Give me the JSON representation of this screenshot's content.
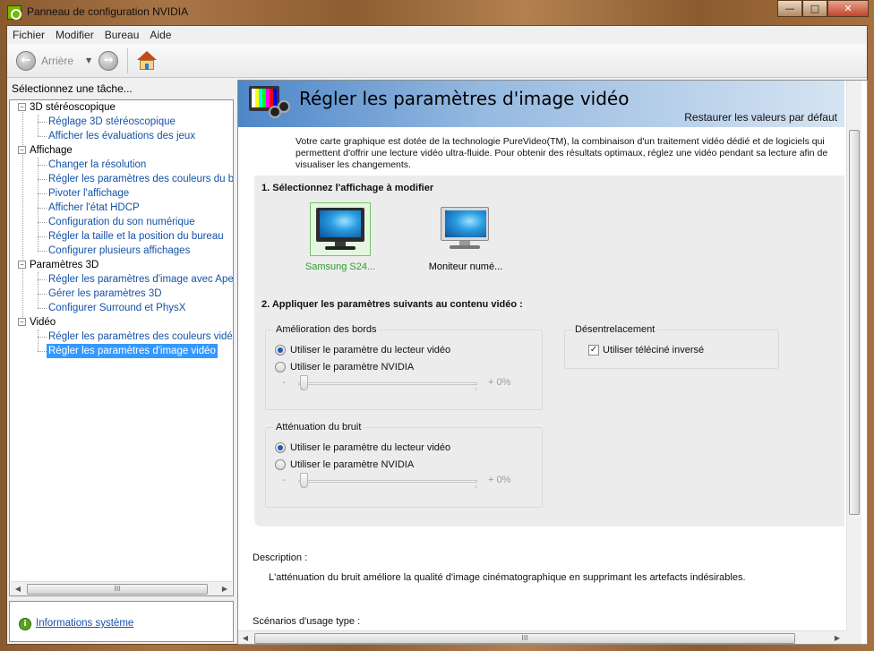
{
  "window": {
    "title": "Panneau de configuration NVIDIA",
    "min_glyph": "—",
    "max_glyph": "□",
    "close_glyph": "✕"
  },
  "menu": [
    "Fichier",
    "Modifier",
    "Bureau",
    "Aide"
  ],
  "toolbar": {
    "back_label": "Arrière",
    "back_glyph": "←",
    "forward_glyph": "→",
    "dropdown_glyph": "▼"
  },
  "left": {
    "header": "Sélectionnez une tâche...",
    "categories": [
      {
        "label": "3D stéréoscopique",
        "items": [
          "Réglage 3D stéréoscopique",
          "Afficher les évaluations des jeux"
        ]
      },
      {
        "label": "Affichage",
        "items": [
          "Changer la résolution",
          "Régler les paramètres des couleurs du bureau",
          "Pivoter l'affichage",
          "Afficher l'état HDCP",
          "Configuration du son numérique",
          "Régler la taille et la position du bureau",
          "Configurer plusieurs affichages"
        ]
      },
      {
        "label": "Paramètres 3D",
        "items": [
          "Régler les paramètres d'image avec Aperçu",
          "Gérer les paramètres 3D",
          "Configurer Surround et PhysX"
        ]
      },
      {
        "label": "Vidéo",
        "items": [
          "Régler les paramètres des couleurs vidéo",
          "Régler les paramètres d'image vidéo"
        ]
      }
    ],
    "selected_item": "Régler les paramètres d'image vidéo",
    "collapse_glyph": "−",
    "sysinfo_link": "Informations système"
  },
  "scroll": {
    "left_glyph": "◀",
    "right_glyph": "▶",
    "grip_glyph": "III"
  },
  "page": {
    "title": "Régler les paramètres d'image vidéo",
    "restore": "Restaurer les valeurs par défaut",
    "intro": "Votre carte graphique est dotée de la technologie PureVideo(TM), la combinaison d'un traitement vidéo dédié et de logiciels qui permettent d'offrir une lecture vidéo ultra-fluide. Pour obtenir des résultats optimaux, réglez une vidéo pendant sa lecture afin de visualiser les changements.",
    "section1": "1. Sélectionnez l'affichage à modifier",
    "displays": [
      {
        "label": "Samsung S24...",
        "selected": true
      },
      {
        "label": "Moniteur numé...",
        "selected": false
      }
    ],
    "section2": "2. Appliquer les paramètres suivants au contenu vidéo :",
    "edge": {
      "legend": "Amélioration des bords",
      "opt1": "Utiliser le paramètre du lecteur vidéo",
      "opt2": "Utiliser le paramètre NVIDIA",
      "min": "-",
      "value": "+ 0%"
    },
    "noise": {
      "legend": "Atténuation du bruit",
      "opt1": "Utiliser le paramètre du lecteur vidéo",
      "opt2": "Utiliser le paramètre NVIDIA",
      "min": "-",
      "value": "+ 0%"
    },
    "deinterlace": {
      "legend": "Désentrelacement",
      "checkbox": "Utiliser téléciné inversé",
      "checked": true,
      "check_glyph": "✓"
    },
    "description_label": "Description :",
    "description_text": "L'atténuation du bruit améliore la qualité d'image cinématographique en supprimant les artefacts indésirables.",
    "scenarios_label": "Scénarios d'usage type :"
  }
}
